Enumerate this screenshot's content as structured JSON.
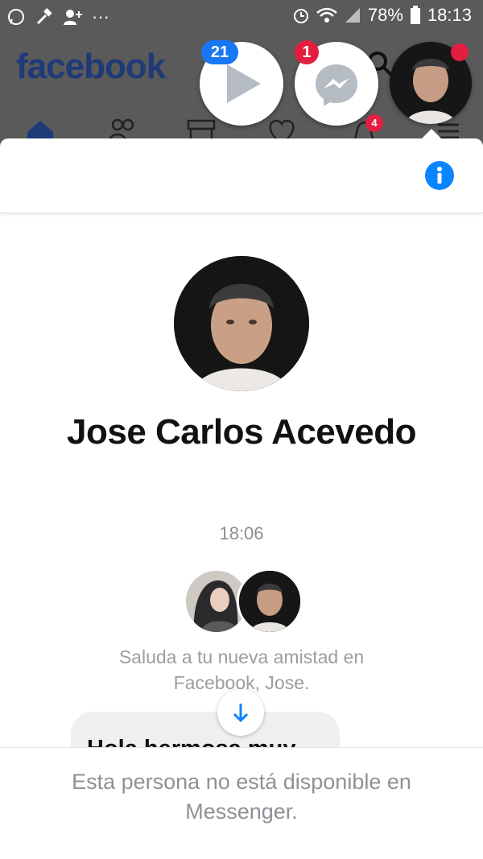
{
  "status_bar": {
    "battery_percent": "78%",
    "time": "18:13",
    "icons": [
      "whatsapp-icon",
      "hammer-icon",
      "add-friend-icon",
      "more-icon",
      "alarm-icon",
      "wifi-icon",
      "signal-icon",
      "battery-icon"
    ]
  },
  "facebook": {
    "logo": "facebook",
    "tabs": [
      "home-icon",
      "friends-icon",
      "marketplace-icon",
      "dating-icon",
      "notifications-icon",
      "menu-icon"
    ],
    "notification_badge": "4",
    "accent": "#1877f2"
  },
  "chat_heads": {
    "video_badge": "21",
    "messenger_badge": "1"
  },
  "conversation": {
    "contact_name": "Jose Carlos Acevedo",
    "timestamp": "18:06",
    "greeting": "Saluda a tu nueva amistad en Facebook, Jose.",
    "message_preview": "Hola hermosa muy",
    "unavailable_notice": "Esta persona no está disponible en Messenger."
  }
}
